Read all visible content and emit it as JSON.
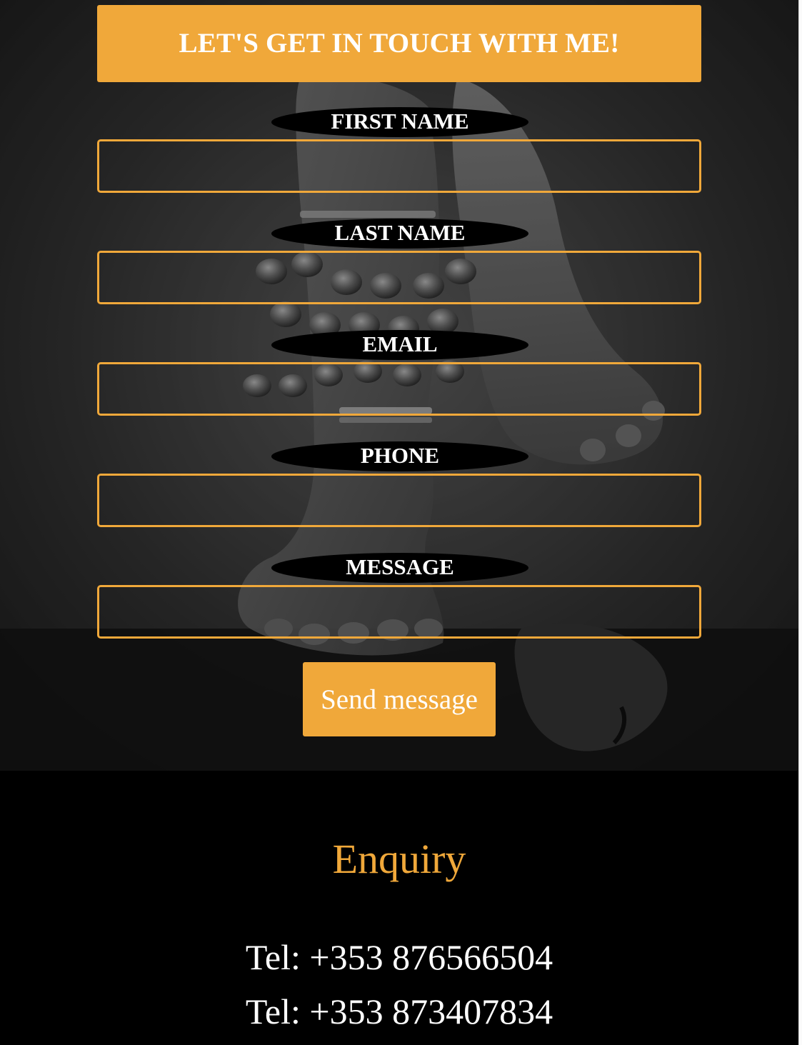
{
  "form": {
    "title": "LET'S GET IN TOUCH WITH ME!",
    "fields": [
      {
        "label": "FIRST NAME",
        "value": ""
      },
      {
        "label": "LAST NAME",
        "value": ""
      },
      {
        "label": "EMAIL",
        "value": ""
      },
      {
        "label": "PHONE",
        "value": ""
      },
      {
        "label": "MESSAGE",
        "value": ""
      }
    ],
    "submit_label": "Send message"
  },
  "footer": {
    "title": "Enquiry",
    "phones": [
      "Tel: +353 876566504",
      "Tel: +353 873407834"
    ]
  },
  "colors": {
    "accent": "#f0a83a",
    "label_bg": "#000000",
    "footer_bg": "#000000"
  },
  "background_image": "black-and-white photo of dancer's feet with ankle bells (ghungroo)"
}
